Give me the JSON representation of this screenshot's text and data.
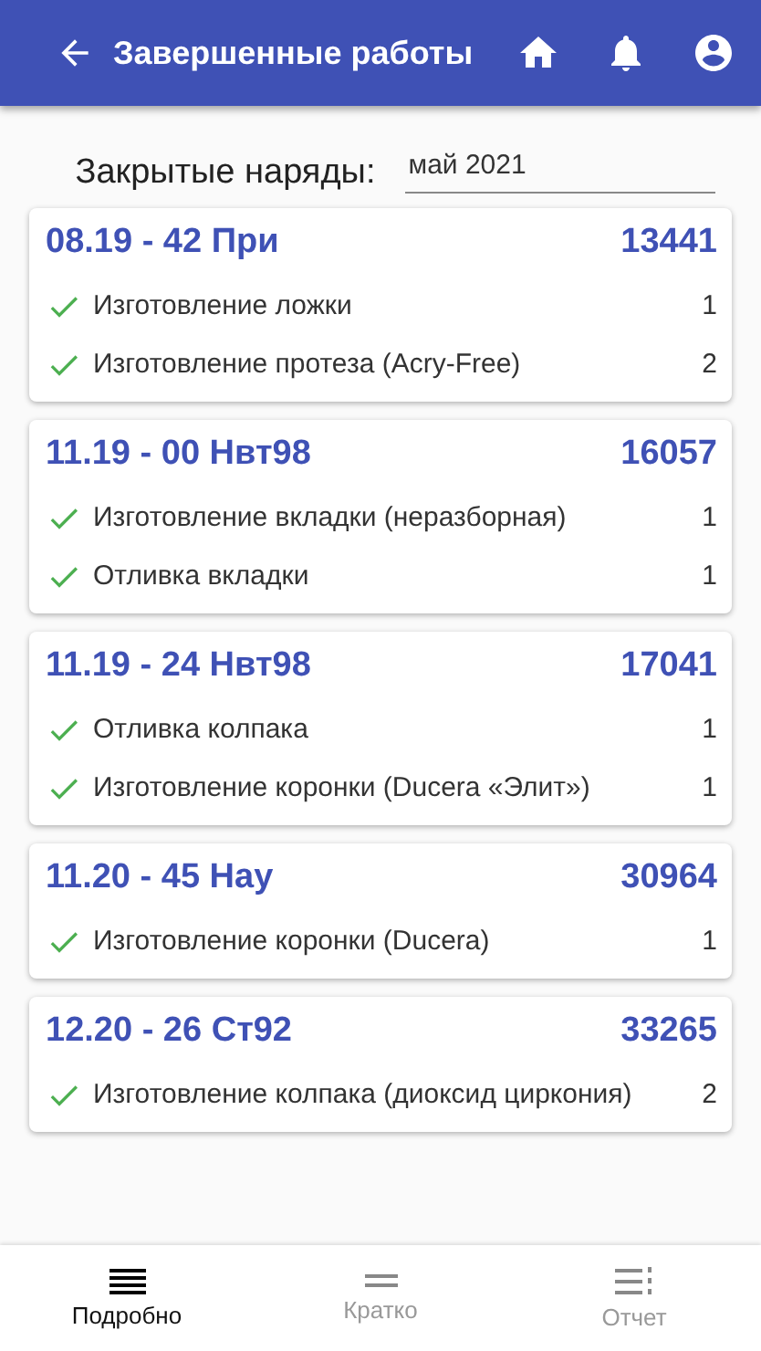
{
  "app_bar": {
    "title": "Завершенные работы"
  },
  "filter": {
    "label": "Закрытые наряды:",
    "value": "май 2021"
  },
  "orders": [
    {
      "title": "08.19 - 42 При",
      "number": "13441",
      "items": [
        {
          "name": "Изготовление ложки",
          "qty": "1",
          "done": true
        },
        {
          "name": "Изготовление протеза (Acry-Free)",
          "qty": "2",
          "done": true
        }
      ]
    },
    {
      "title": "11.19 - 00 Нвт98",
      "number": "16057",
      "items": [
        {
          "name": "Изготовление вкладки (неразборная)",
          "qty": "1",
          "done": true
        },
        {
          "name": "Отливка вкладки",
          "qty": "1",
          "done": true
        }
      ]
    },
    {
      "title": "11.19 - 24 Нвт98",
      "number": "17041",
      "items": [
        {
          "name": "Отливка колпака",
          "qty": "1",
          "done": true
        },
        {
          "name": "Изготовление коронки (Ducera «Элит»)",
          "qty": "1",
          "done": true
        }
      ]
    },
    {
      "title": "11.20 - 45 Нау",
      "number": "30964",
      "items": [
        {
          "name": "Изготовление коронки (Ducera)",
          "qty": "1",
          "done": true
        }
      ]
    },
    {
      "title": "12.20 - 26 Ст92",
      "number": "33265",
      "items": [
        {
          "name": "Изготовление колпака (диоксид циркония)",
          "qty": "2",
          "done": true
        }
      ]
    }
  ],
  "bottom_nav": [
    {
      "label": "Подробно",
      "kind": "detailed",
      "selected": true
    },
    {
      "label": "Кратко",
      "kind": "brief",
      "selected": false
    },
    {
      "label": "Отчет",
      "kind": "report",
      "selected": false
    }
  ]
}
